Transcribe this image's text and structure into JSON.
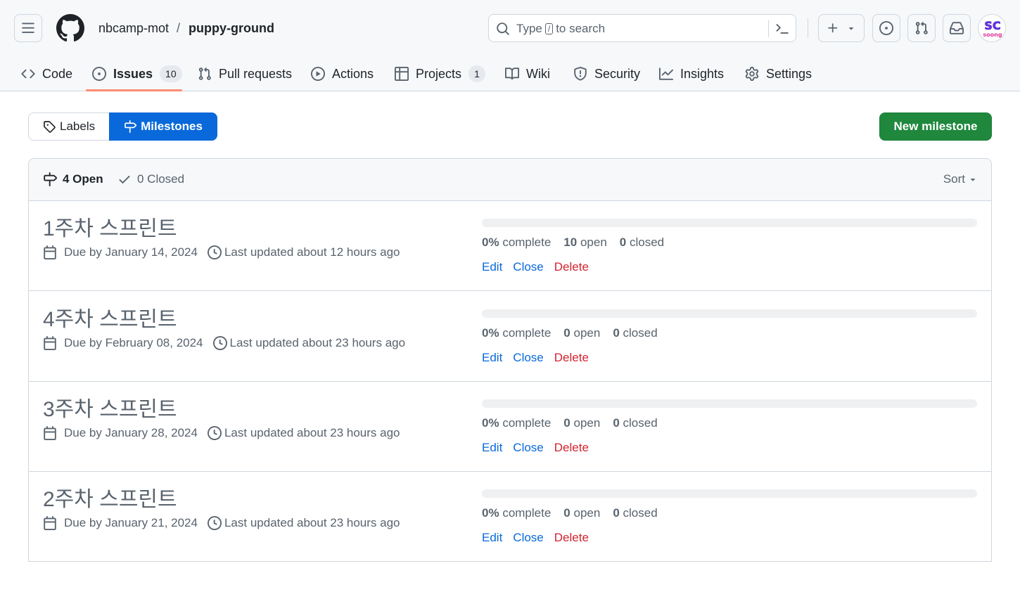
{
  "repo": {
    "owner": "nbcamp-mot",
    "separator": "/",
    "name": "puppy-ground"
  },
  "search": {
    "prefix": "Type",
    "key": "/",
    "suffix": "to search"
  },
  "nav": {
    "tabs": [
      {
        "label": "Code",
        "icon": "code-icon"
      },
      {
        "label": "Issues",
        "icon": "issue-opened-icon",
        "counter": "10",
        "selected": true
      },
      {
        "label": "Pull requests",
        "icon": "git-pull-request-icon"
      },
      {
        "label": "Actions",
        "icon": "play-icon"
      },
      {
        "label": "Projects",
        "icon": "table-icon",
        "counter": "1"
      },
      {
        "label": "Wiki",
        "icon": "book-icon"
      },
      {
        "label": "Security",
        "icon": "shield-icon"
      },
      {
        "label": "Insights",
        "icon": "graph-icon"
      },
      {
        "label": "Settings",
        "icon": "gear-icon"
      }
    ]
  },
  "subnav": {
    "labels": "Labels",
    "milestones": "Milestones"
  },
  "new_milestone_label": "New milestone",
  "filter": {
    "open": "4 Open",
    "closed": "0 Closed",
    "sort": "Sort"
  },
  "milestones": [
    {
      "title": "1주차 스프린트",
      "due": "Due by January 14, 2024",
      "updated": "Last updated about 12 hours ago",
      "percent": "0%",
      "complete_word": "complete",
      "open_count": "10",
      "open_word": "open",
      "closed_count": "0",
      "closed_word": "closed",
      "progress": 0
    },
    {
      "title": "4주차 스프린트",
      "due": "Due by February 08, 2024",
      "updated": "Last updated about 23 hours ago",
      "percent": "0%",
      "complete_word": "complete",
      "open_count": "0",
      "open_word": "open",
      "closed_count": "0",
      "closed_word": "closed",
      "progress": 0
    },
    {
      "title": "3주차 스프린트",
      "due": "Due by January 28, 2024",
      "updated": "Last updated about 23 hours ago",
      "percent": "0%",
      "complete_word": "complete",
      "open_count": "0",
      "open_word": "open",
      "closed_count": "0",
      "closed_word": "closed",
      "progress": 0
    },
    {
      "title": "2주차 스프린트",
      "due": "Due by January 21, 2024",
      "updated": "Last updated about 23 hours ago",
      "percent": "0%",
      "complete_word": "complete",
      "open_count": "0",
      "open_word": "open",
      "closed_count": "0",
      "closed_word": "closed",
      "progress": 0
    }
  ],
  "row_actions": {
    "edit": "Edit",
    "close": "Close",
    "delete": "Delete"
  },
  "colors": {
    "accent": "#0969da",
    "primary_button": "#1f883d",
    "danger": "#d1242f",
    "selected_tab_underline": "#fd8c73"
  }
}
